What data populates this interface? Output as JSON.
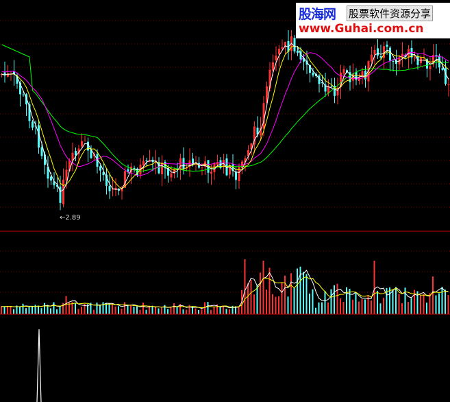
{
  "watermark": {
    "site_name": "股海网",
    "tagline": "股票软件资源分享",
    "url": "www.Guhai.com.cn"
  },
  "price_annotation": {
    "low_label": "←2.89"
  },
  "colors": {
    "background": "#000000",
    "up_candle": "#ff3232",
    "down_candle": "#54fcfc",
    "ma_short": "#ffffff",
    "ma_mid": "#ffff00",
    "ma_long1": "#ff00ff",
    "ma_long2": "#00ff00",
    "grid": "#8b0000",
    "divider": "#c00000"
  },
  "chart_data": {
    "type": "candlestick",
    "indicator_panel": "volume",
    "indicator_2_visible_spike_index": 14
  }
}
